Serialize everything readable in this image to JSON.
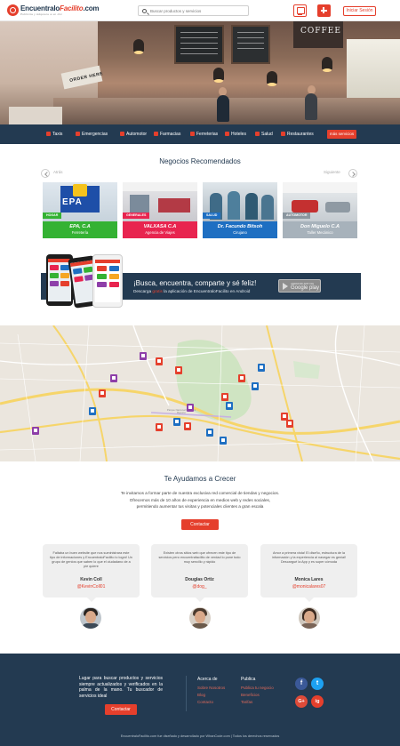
{
  "header": {
    "logo_main": "Encuentralo",
    "logo_accent": "Facilito",
    "logo_suffix": ".com",
    "logo_tagline": "Publicita y Adquiere a un clic",
    "search_placeholder": "Buscar productos y servicios",
    "login_label": "Iniciar Sesión"
  },
  "hero": {
    "sign_text": "ORDER HERE",
    "coffee_text": "COFFEE"
  },
  "categories": [
    {
      "label": "Taxis"
    },
    {
      "label": "Emergencias"
    },
    {
      "label": "Automotor"
    },
    {
      "label": "Farmacias"
    },
    {
      "label": "Ferreterias"
    },
    {
      "label": "Hoteles"
    },
    {
      "label": "Salud"
    },
    {
      "label": "Restaurantes"
    }
  ],
  "categories_more": "más servicios",
  "recommended": {
    "title": "Negocios Recomendados",
    "prev_label": "Atrás",
    "next_label": "Siguiente",
    "cards": [
      {
        "tag": "HOGAR",
        "name": "EPA, C.A",
        "category": "Ferretería",
        "color": "#34b233",
        "logo": "EPA"
      },
      {
        "tag": "GENERALES",
        "name": "VALXASA C.A",
        "category": "Agencia de Viajes",
        "color": "#e8244f"
      },
      {
        "tag": "SALUD",
        "name": "Dr. Facundo Bitsoh",
        "category": "Cirujano",
        "color": "#1e6fc2"
      },
      {
        "tag": "AUTOMOTOR",
        "name": "Don Miguelo C.A",
        "category": "Taller Mecánico",
        "color": "#a7b2bb"
      }
    ]
  },
  "app_banner": {
    "title": "¡Busca, encuentra, comparte y sé feliz!",
    "sub_before": "Descarga ",
    "sub_highlight": "gratis",
    "sub_after": " la aplicación de EncuentraloFacilito en Android",
    "store_small": "ANDROID APP ON",
    "store_big": "Google play"
  },
  "map": {
    "park_label": "Parque Nacional Guaraira Repano",
    "pins": [
      {
        "color": "#8e3fa9"
      },
      {
        "color": "#e53f2c"
      },
      {
        "color": "#e53f2c"
      },
      {
        "color": "#1e6fc2"
      },
      {
        "color": "#8e3fa9"
      },
      {
        "color": "#e53f2c"
      },
      {
        "color": "#1e6fc2"
      },
      {
        "color": "#e53f2c"
      },
      {
        "color": "#e53f2c"
      },
      {
        "color": "#1e6fc2"
      },
      {
        "color": "#8e3fa9"
      },
      {
        "color": "#1e6fc2"
      },
      {
        "color": "#e53f2c"
      },
      {
        "color": "#1e6fc2"
      },
      {
        "color": "#e53f2c"
      },
      {
        "color": "#e53f2c"
      },
      {
        "color": "#1e6fc2"
      },
      {
        "color": "#8e3fa9"
      },
      {
        "color": "#e53f2c"
      },
      {
        "color": "#1e6fc2"
      }
    ]
  },
  "help": {
    "title": "Te Ayudamos a Crecer",
    "line1": "Te invitamos a formar parte de nuestra exclusiva red comercial de tiendas y negocios.",
    "line2": "Ofrecemos más de 10 años de experiencia en medios web y redes sociales,",
    "line3": "permitiendo aumentar tus visitas y potenciales clientes a gran escala",
    "button": "Contactar"
  },
  "testimonials": [
    {
      "quote": "Faltaba un buen website que nos suministrara este tipo de informaciones y EncuentraloFacilito lo logró! Un grupo de genios que saben lo que el ciudadano de a pie quiere",
      "name": "Kevin Coll",
      "handle": "@KevinColl01"
    },
    {
      "quote": "Existen otros sitios web que ofrecen este tipo de servicios pero encuentrafacilito de verdad lo pone todo muy sencillo y rápido",
      "name": "Douglas Ortiz",
      "handle": "@dog_"
    },
    {
      "quote": "Amor a primera vista! El diseño, estructura de la información y la experiencia al navegar es genial! Descargué la App y es super cómoda",
      "name": "Monica Lares",
      "handle": "@monicalares07"
    }
  ],
  "footer": {
    "about": "Lugar para buscar productos y servicios siempre actualizados y verificados en la palma de la mano. Tu buscador de servicios ideal",
    "contact_button": "Contactar",
    "col1_title": "Acerca de",
    "col1_links": [
      "Sobre Nosotros",
      "Blog",
      "Contacto"
    ],
    "col2_title": "Publica",
    "col2_links": [
      "Publica tu negocio",
      "Beneficios",
      "Tarifas"
    ],
    "social": [
      {
        "icon": "f",
        "color": "#3b5998"
      },
      {
        "icon": "t",
        "color": "#1da1f2"
      },
      {
        "icon": "G+",
        "color": "#dd4b39"
      },
      {
        "icon": "ig",
        "color": "#e53f2c"
      }
    ],
    "bottom": "EncuentraloFacilito.com fue diseñado y desarrollado por WhanCode.com  |  Todos los derechos reservados"
  },
  "colors": {
    "brand_red": "#e53f2c",
    "navy": "#233a51"
  }
}
